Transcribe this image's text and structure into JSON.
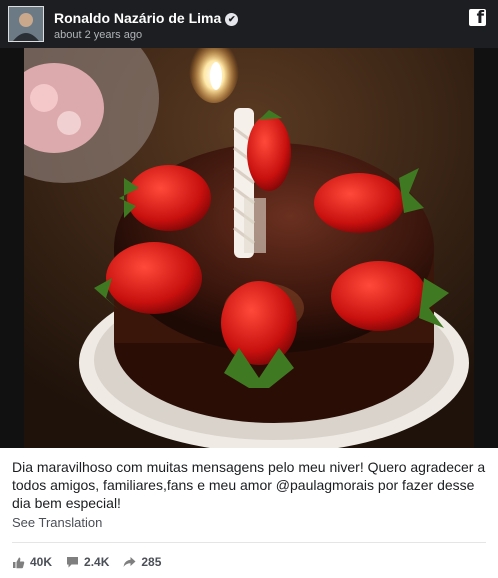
{
  "post": {
    "author": "Ronaldo Nazário de Lima",
    "time": "about 2 years ago",
    "caption": "Dia maravilhoso com muitas mensagens pelo meu niver! Quero agradecer a todos amigos, familiares,fans e meu amor @paulagmorais por fazer desse dia bem especial!",
    "see_translation": "See Translation"
  },
  "stats": {
    "likes": "40K",
    "comments": "2.4K",
    "shares": "285"
  },
  "icons": {
    "verified": "verified-check-icon",
    "facebook": "facebook-logo-icon",
    "like": "thumbs-up-icon",
    "comment": "comment-bubble-icon",
    "share": "share-arrow-icon"
  }
}
